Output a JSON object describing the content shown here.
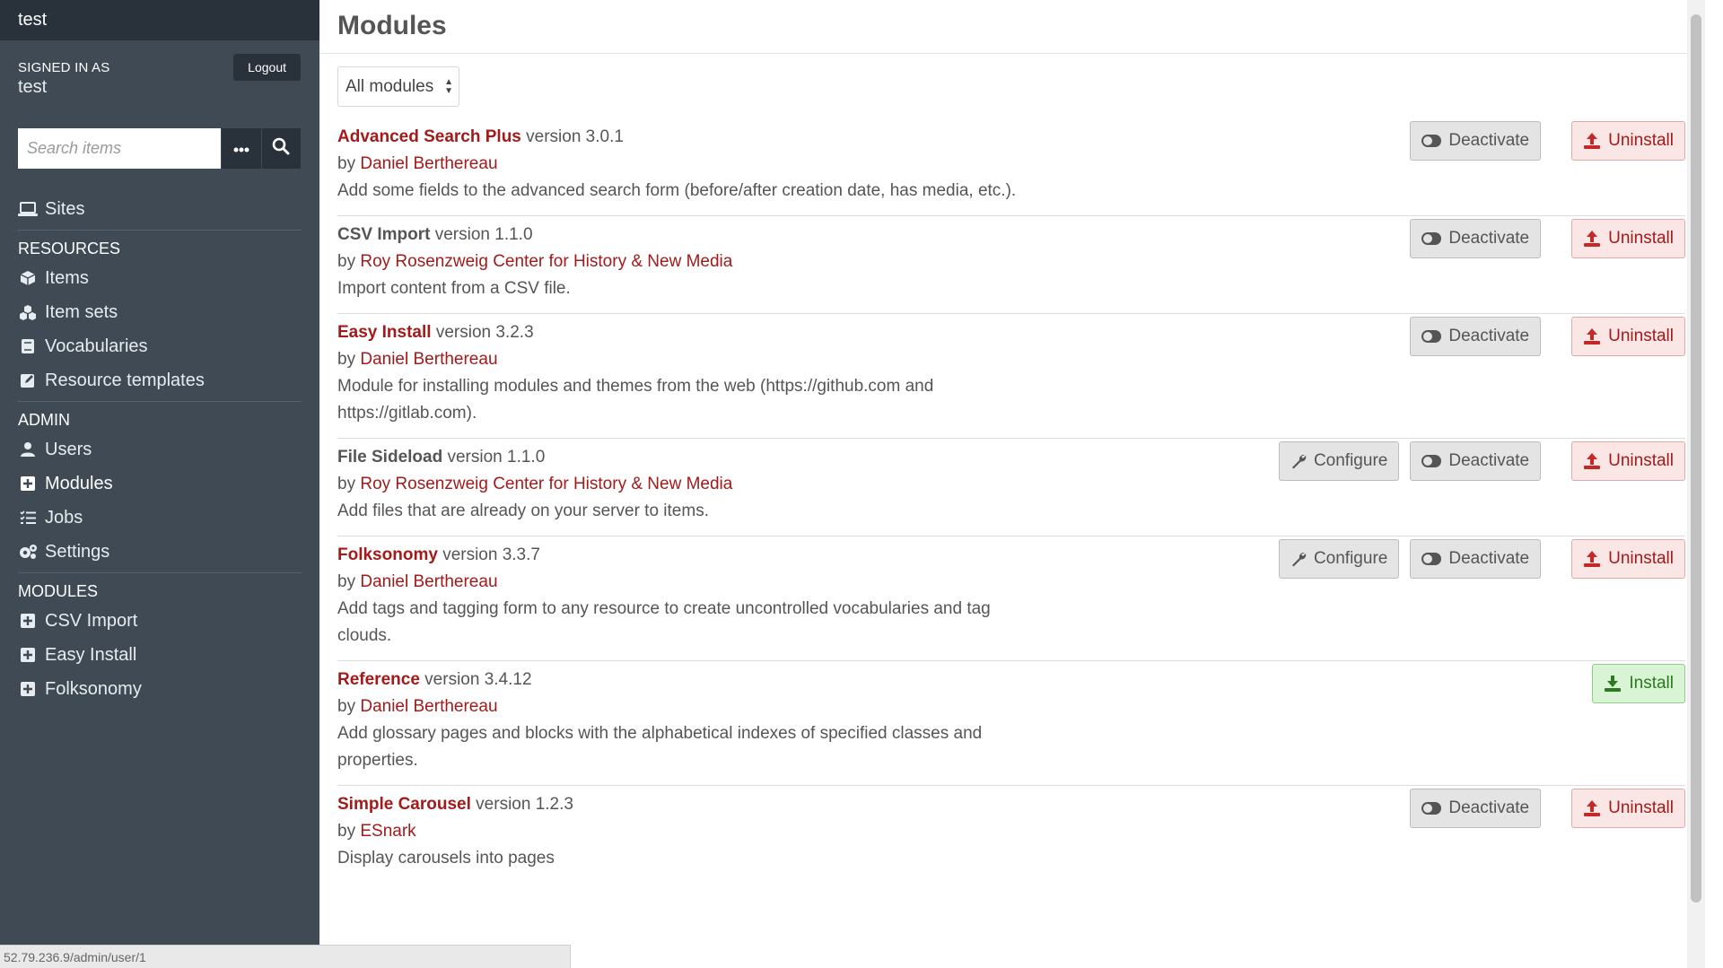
{
  "site": {
    "title": "test"
  },
  "user": {
    "signed_in_label": "SIGNED IN AS",
    "name": "test",
    "logout_label": "Logout"
  },
  "search": {
    "placeholder": "Search items",
    "options_icon": "ellipsis-icon",
    "submit_icon": "search-icon"
  },
  "nav": {
    "sites_label": "Sites",
    "resources_heading": "RESOURCES",
    "resources": [
      {
        "label": "Items",
        "icon": "cube-icon"
      },
      {
        "label": "Item sets",
        "icon": "cubes-icon"
      },
      {
        "label": "Vocabularies",
        "icon": "book-icon"
      },
      {
        "label": "Resource templates",
        "icon": "edit-icon"
      }
    ],
    "admin_heading": "ADMIN",
    "admin": [
      {
        "label": "Users",
        "icon": "user-icon"
      },
      {
        "label": "Modules",
        "icon": "plus-square-icon",
        "active": true
      },
      {
        "label": "Jobs",
        "icon": "tasks-icon"
      },
      {
        "label": "Settings",
        "icon": "cogs-icon"
      }
    ],
    "modules_heading": "MODULES",
    "modules": [
      {
        "label": "CSV Import",
        "icon": "plus-square-icon"
      },
      {
        "label": "Easy Install",
        "icon": "plus-square-icon"
      },
      {
        "label": "Folksonomy",
        "icon": "plus-square-icon"
      }
    ]
  },
  "status_url": "52.79.236.9/admin/user/1",
  "page": {
    "title": "Modules",
    "filter_value": "All modules"
  },
  "buttons": {
    "configure": "Configure",
    "deactivate": "Deactivate",
    "uninstall": "Uninstall",
    "install": "Install"
  },
  "modules_list": [
    {
      "name": "Advanced Search Plus",
      "version": "version 3.0.1",
      "by": "by",
      "author": "Daniel Berthereau",
      "desc": "Add some fields to the advanced search form (before/after creation date, has media, etc.)."
    },
    {
      "name": "CSV Import",
      "version": "version 1.1.0",
      "by": "by",
      "author": "Roy Rosenzweig Center for History & New Media",
      "desc": "Import content from a CSV file."
    },
    {
      "name": "Easy Install",
      "version": "version 3.2.3",
      "by": "by",
      "author": "Daniel Berthereau",
      "desc": "Module for installing modules and themes from the web (https://github.com and https://gitlab.com)."
    },
    {
      "name": "File Sideload",
      "version": "version 1.1.0",
      "by": "by",
      "author": "Roy Rosenzweig Center for History & New Media",
      "desc": "Add files that are already on your server to items."
    },
    {
      "name": "Folksonomy",
      "version": "version 3.3.7",
      "by": "by",
      "author": "Daniel Berthereau",
      "desc": "Add tags and tagging form to any resource to create uncontrolled vocabularies and tag clouds."
    },
    {
      "name": "Reference",
      "version": "version 3.4.12",
      "by": "by",
      "author": "Daniel Berthereau",
      "desc": "Add glossary pages and blocks with the alphabetical indexes of specified classes and properties."
    },
    {
      "name": "Simple Carousel",
      "version": "version 1.2.3",
      "by": "by",
      "author": "ESnark",
      "desc": "Display carousels into pages"
    }
  ],
  "colors": {
    "sidebar": "#3f4a55",
    "sidebar_dark": "#29323b",
    "accent_red": "#a31a1a",
    "install_green": "#2c7a20"
  }
}
